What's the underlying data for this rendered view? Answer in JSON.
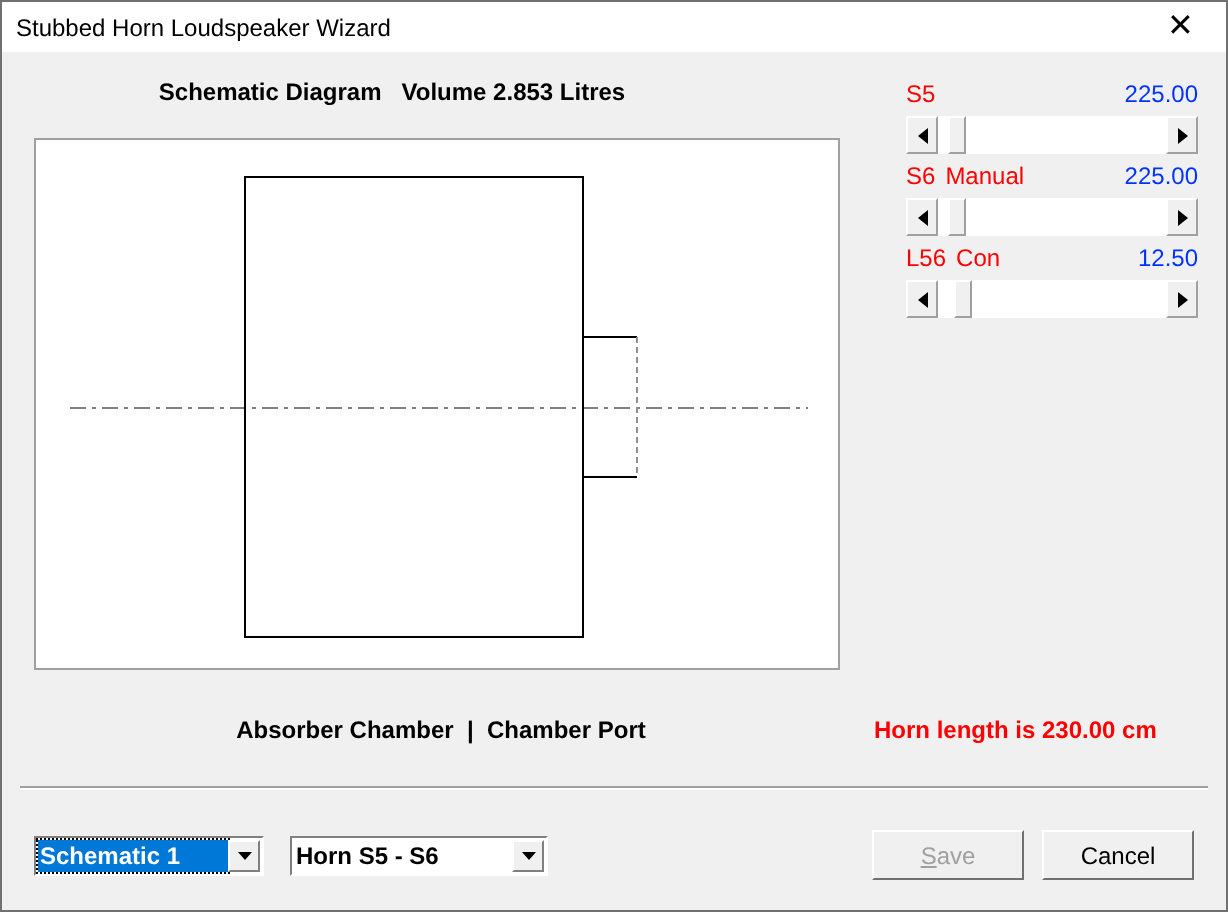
{
  "window": {
    "title": "Stubbed Horn Loudspeaker Wizard",
    "close": "✕"
  },
  "diagram": {
    "title": "Schematic Diagram   Volume 2.853 Litres",
    "caption": "Absorber Chamber  |  Chamber Port"
  },
  "sliders": [
    {
      "name": "S5",
      "reading": "225.00",
      "level": 0.05
    },
    {
      "name": "S6",
      "mode": "Manual",
      "reading": "225.00",
      "level": 0.05
    },
    {
      "name": "L56",
      "mode": "Con",
      "reading": "12.50",
      "level": 0.08
    }
  ],
  "horn_length": "Horn length is 230.00 cm",
  "dropdowns": [
    {
      "value": "Schematic 1",
      "focused": true
    },
    {
      "value": "Horn S5 - S6",
      "focused": false
    }
  ],
  "buttons": [
    {
      "label": "Save",
      "mnemonic": true,
      "disabled": true
    },
    {
      "label": "Cancel",
      "disabled": false
    }
  ]
}
